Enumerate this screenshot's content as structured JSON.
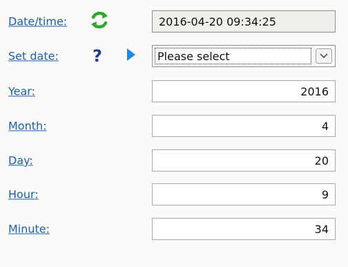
{
  "datetime": {
    "label": "Date/time:",
    "value": "2016-04-20 09:34:25",
    "refresh_icon": "refresh-icon"
  },
  "set_date": {
    "label": "Set date:",
    "help_glyph": "?",
    "help_icon": "help-icon",
    "arrow_icon": "arrow-right-icon",
    "select_value": "Please select",
    "dropdown_icon": "chevron-down-icon"
  },
  "fields": {
    "year": {
      "label": "Year:",
      "value": "2016"
    },
    "month": {
      "label": "Month:",
      "value": "4"
    },
    "day": {
      "label": "Day:",
      "value": "20"
    },
    "hour": {
      "label": "Hour:",
      "value": "9"
    },
    "minute": {
      "label": "Minute:",
      "value": "34"
    }
  },
  "colors": {
    "link": "#1a5fb4",
    "refresh": "#2ea82e",
    "arrow": "#1e88e5",
    "help": "#1a3f8f"
  }
}
